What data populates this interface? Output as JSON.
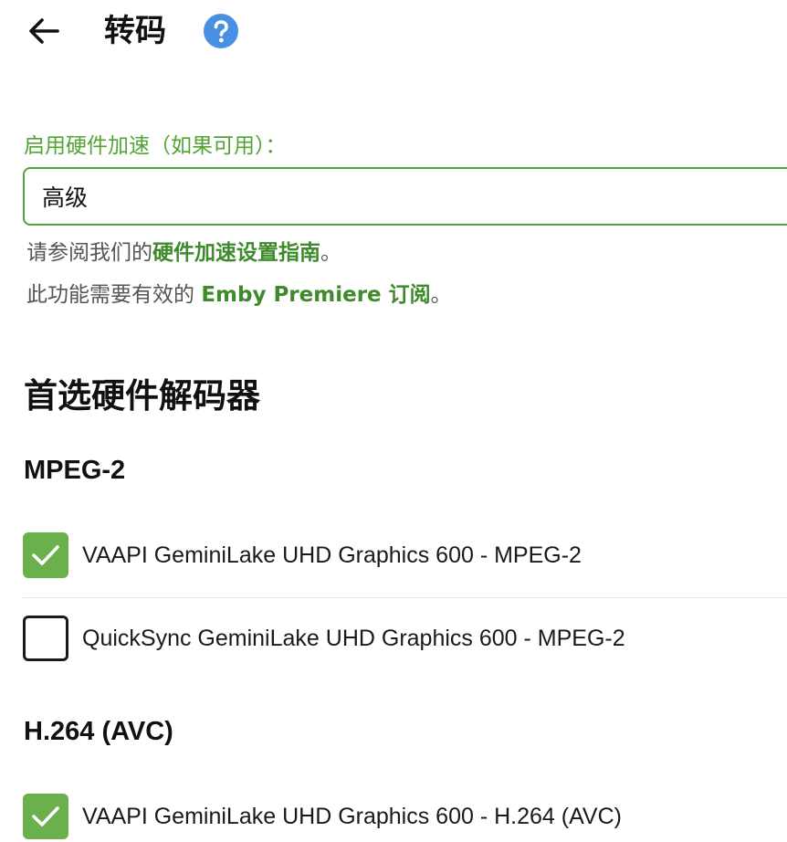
{
  "header": {
    "title": "转码",
    "back_icon": "arrow-left-icon",
    "help_icon": "help-circle-icon",
    "help_color": "#4a90e2"
  },
  "hw_accel": {
    "label": "启用硬件加速（如果可用）：",
    "value": "高级",
    "accent_color": "#52a435"
  },
  "help": {
    "line1_prefix": "请参阅我们的",
    "line1_link": "硬件加速设置指南",
    "line1_suffix": "。",
    "line2_prefix": "此功能需要有效的 ",
    "line2_link": "Emby Premiere 订阅",
    "line2_suffix": "。"
  },
  "decoders": {
    "title": "首选硬件解码器",
    "groups": [
      {
        "heading": "MPEG-2",
        "options": [
          {
            "label": "VAAPI GeminiLake UHD Graphics 600 - MPEG-2",
            "checked": true
          },
          {
            "label": "QuickSync GeminiLake UHD Graphics 600 - MPEG-2",
            "checked": false
          }
        ]
      },
      {
        "heading": "H.264 (AVC)",
        "options": [
          {
            "label": "VAAPI GeminiLake UHD Graphics 600 - H.264 (AVC)",
            "checked": true
          }
        ]
      }
    ]
  }
}
